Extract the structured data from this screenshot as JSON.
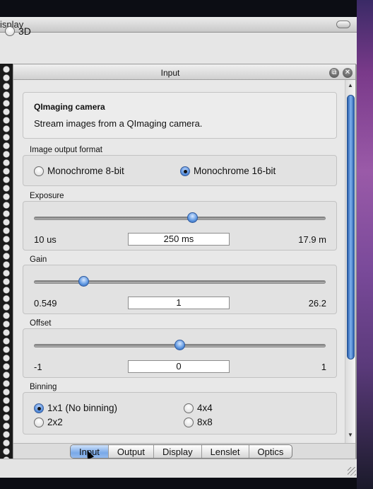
{
  "display_window": {
    "title": "isplay",
    "mode_option": {
      "label": "3D",
      "selected": false
    }
  },
  "input_panel": {
    "title": "Input",
    "float_icon": "restore-icon",
    "close_icon": "close-icon",
    "description": {
      "title": "QImaging camera",
      "text": "Stream images from a QImaging camera."
    },
    "image_output_format": {
      "label": "Image output format",
      "options": [
        {
          "label": "Monochrome 8-bit",
          "selected": false
        },
        {
          "label": "Monochrome 16-bit",
          "selected": true
        }
      ]
    },
    "exposure": {
      "label": "Exposure",
      "min": "10 us",
      "value": "250 ms",
      "max": "17.9  m",
      "slider_fraction": 0.54
    },
    "gain": {
      "label": "Gain",
      "min": "0.549",
      "value": "1",
      "max": "26.2",
      "slider_fraction": 0.17
    },
    "offset": {
      "label": "Offset",
      "min": "-1",
      "value": "0",
      "max": "1",
      "slider_fraction": 0.5
    },
    "binning": {
      "label": "Binning",
      "options": [
        {
          "label": "1x1 (No binning)",
          "selected": true
        },
        {
          "label": "4x4",
          "selected": false
        },
        {
          "label": "2x2",
          "selected": false
        },
        {
          "label": "8x8",
          "selected": false
        }
      ]
    }
  },
  "tabs": [
    {
      "label": "Input",
      "active": true
    },
    {
      "label": "Output",
      "active": false
    },
    {
      "label": "Display",
      "active": false
    },
    {
      "label": "Lenslet",
      "active": false
    },
    {
      "label": "Optics",
      "active": false
    }
  ],
  "colors": {
    "accent": "#4d87d8",
    "panel_bg": "#e8e8e8"
  }
}
